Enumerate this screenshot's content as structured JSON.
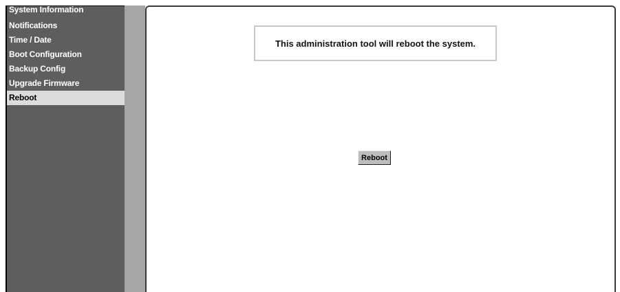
{
  "sidebar": {
    "items": [
      {
        "label": "System Information"
      },
      {
        "label": "Notifications"
      },
      {
        "label": "Time / Date"
      },
      {
        "label": "Boot Configuration"
      },
      {
        "label": "Backup Config"
      },
      {
        "label": "Upgrade Firmware"
      },
      {
        "label": "Reboot",
        "active": true
      }
    ]
  },
  "main": {
    "message": "This administration tool will reboot the system.",
    "reboot_button_label": "Reboot"
  },
  "colors": {
    "sidebar_bg": "#5e5e5e",
    "sidebar_active_bg": "#dcdcdc",
    "divider_strip": "#a6a6a6",
    "button_bg": "#bdbdbd"
  }
}
